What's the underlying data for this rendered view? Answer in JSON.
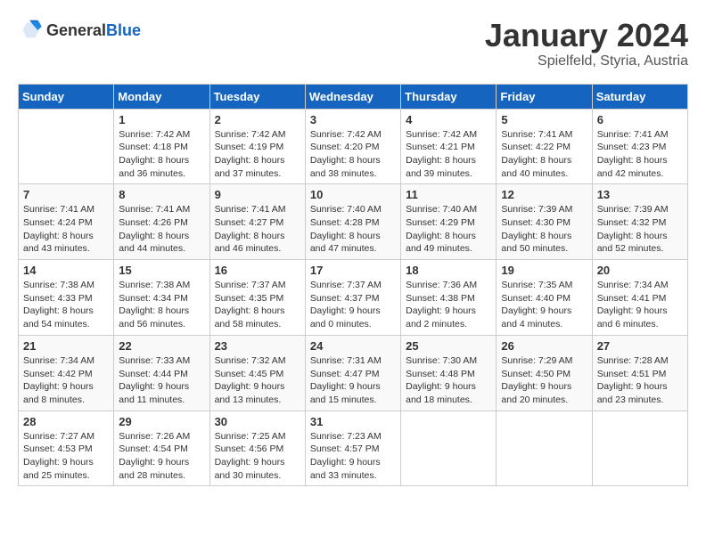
{
  "header": {
    "logo_general": "General",
    "logo_blue": "Blue",
    "title": "January 2024",
    "subtitle": "Spielfeld, Styria, Austria"
  },
  "calendar": {
    "days_of_week": [
      "Sunday",
      "Monday",
      "Tuesday",
      "Wednesday",
      "Thursday",
      "Friday",
      "Saturday"
    ],
    "weeks": [
      [
        {
          "day": "",
          "sunrise": "",
          "sunset": "",
          "daylight": ""
        },
        {
          "day": "1",
          "sunrise": "Sunrise: 7:42 AM",
          "sunset": "Sunset: 4:18 PM",
          "daylight": "Daylight: 8 hours and 36 minutes."
        },
        {
          "day": "2",
          "sunrise": "Sunrise: 7:42 AM",
          "sunset": "Sunset: 4:19 PM",
          "daylight": "Daylight: 8 hours and 37 minutes."
        },
        {
          "day": "3",
          "sunrise": "Sunrise: 7:42 AM",
          "sunset": "Sunset: 4:20 PM",
          "daylight": "Daylight: 8 hours and 38 minutes."
        },
        {
          "day": "4",
          "sunrise": "Sunrise: 7:42 AM",
          "sunset": "Sunset: 4:21 PM",
          "daylight": "Daylight: 8 hours and 39 minutes."
        },
        {
          "day": "5",
          "sunrise": "Sunrise: 7:41 AM",
          "sunset": "Sunset: 4:22 PM",
          "daylight": "Daylight: 8 hours and 40 minutes."
        },
        {
          "day": "6",
          "sunrise": "Sunrise: 7:41 AM",
          "sunset": "Sunset: 4:23 PM",
          "daylight": "Daylight: 8 hours and 42 minutes."
        }
      ],
      [
        {
          "day": "7",
          "sunrise": "Sunrise: 7:41 AM",
          "sunset": "Sunset: 4:24 PM",
          "daylight": "Daylight: 8 hours and 43 minutes."
        },
        {
          "day": "8",
          "sunrise": "Sunrise: 7:41 AM",
          "sunset": "Sunset: 4:26 PM",
          "daylight": "Daylight: 8 hours and 44 minutes."
        },
        {
          "day": "9",
          "sunrise": "Sunrise: 7:41 AM",
          "sunset": "Sunset: 4:27 PM",
          "daylight": "Daylight: 8 hours and 46 minutes."
        },
        {
          "day": "10",
          "sunrise": "Sunrise: 7:40 AM",
          "sunset": "Sunset: 4:28 PM",
          "daylight": "Daylight: 8 hours and 47 minutes."
        },
        {
          "day": "11",
          "sunrise": "Sunrise: 7:40 AM",
          "sunset": "Sunset: 4:29 PM",
          "daylight": "Daylight: 8 hours and 49 minutes."
        },
        {
          "day": "12",
          "sunrise": "Sunrise: 7:39 AM",
          "sunset": "Sunset: 4:30 PM",
          "daylight": "Daylight: 8 hours and 50 minutes."
        },
        {
          "day": "13",
          "sunrise": "Sunrise: 7:39 AM",
          "sunset": "Sunset: 4:32 PM",
          "daylight": "Daylight: 8 hours and 52 minutes."
        }
      ],
      [
        {
          "day": "14",
          "sunrise": "Sunrise: 7:38 AM",
          "sunset": "Sunset: 4:33 PM",
          "daylight": "Daylight: 8 hours and 54 minutes."
        },
        {
          "day": "15",
          "sunrise": "Sunrise: 7:38 AM",
          "sunset": "Sunset: 4:34 PM",
          "daylight": "Daylight: 8 hours and 56 minutes."
        },
        {
          "day": "16",
          "sunrise": "Sunrise: 7:37 AM",
          "sunset": "Sunset: 4:35 PM",
          "daylight": "Daylight: 8 hours and 58 minutes."
        },
        {
          "day": "17",
          "sunrise": "Sunrise: 7:37 AM",
          "sunset": "Sunset: 4:37 PM",
          "daylight": "Daylight: 9 hours and 0 minutes."
        },
        {
          "day": "18",
          "sunrise": "Sunrise: 7:36 AM",
          "sunset": "Sunset: 4:38 PM",
          "daylight": "Daylight: 9 hours and 2 minutes."
        },
        {
          "day": "19",
          "sunrise": "Sunrise: 7:35 AM",
          "sunset": "Sunset: 4:40 PM",
          "daylight": "Daylight: 9 hours and 4 minutes."
        },
        {
          "day": "20",
          "sunrise": "Sunrise: 7:34 AM",
          "sunset": "Sunset: 4:41 PM",
          "daylight": "Daylight: 9 hours and 6 minutes."
        }
      ],
      [
        {
          "day": "21",
          "sunrise": "Sunrise: 7:34 AM",
          "sunset": "Sunset: 4:42 PM",
          "daylight": "Daylight: 9 hours and 8 minutes."
        },
        {
          "day": "22",
          "sunrise": "Sunrise: 7:33 AM",
          "sunset": "Sunset: 4:44 PM",
          "daylight": "Daylight: 9 hours and 11 minutes."
        },
        {
          "day": "23",
          "sunrise": "Sunrise: 7:32 AM",
          "sunset": "Sunset: 4:45 PM",
          "daylight": "Daylight: 9 hours and 13 minutes."
        },
        {
          "day": "24",
          "sunrise": "Sunrise: 7:31 AM",
          "sunset": "Sunset: 4:47 PM",
          "daylight": "Daylight: 9 hours and 15 minutes."
        },
        {
          "day": "25",
          "sunrise": "Sunrise: 7:30 AM",
          "sunset": "Sunset: 4:48 PM",
          "daylight": "Daylight: 9 hours and 18 minutes."
        },
        {
          "day": "26",
          "sunrise": "Sunrise: 7:29 AM",
          "sunset": "Sunset: 4:50 PM",
          "daylight": "Daylight: 9 hours and 20 minutes."
        },
        {
          "day": "27",
          "sunrise": "Sunrise: 7:28 AM",
          "sunset": "Sunset: 4:51 PM",
          "daylight": "Daylight: 9 hours and 23 minutes."
        }
      ],
      [
        {
          "day": "28",
          "sunrise": "Sunrise: 7:27 AM",
          "sunset": "Sunset: 4:53 PM",
          "daylight": "Daylight: 9 hours and 25 minutes."
        },
        {
          "day": "29",
          "sunrise": "Sunrise: 7:26 AM",
          "sunset": "Sunset: 4:54 PM",
          "daylight": "Daylight: 9 hours and 28 minutes."
        },
        {
          "day": "30",
          "sunrise": "Sunrise: 7:25 AM",
          "sunset": "Sunset: 4:56 PM",
          "daylight": "Daylight: 9 hours and 30 minutes."
        },
        {
          "day": "31",
          "sunrise": "Sunrise: 7:23 AM",
          "sunset": "Sunset: 4:57 PM",
          "daylight": "Daylight: 9 hours and 33 minutes."
        },
        {
          "day": "",
          "sunrise": "",
          "sunset": "",
          "daylight": ""
        },
        {
          "day": "",
          "sunrise": "",
          "sunset": "",
          "daylight": ""
        },
        {
          "day": "",
          "sunrise": "",
          "sunset": "",
          "daylight": ""
        }
      ]
    ]
  }
}
